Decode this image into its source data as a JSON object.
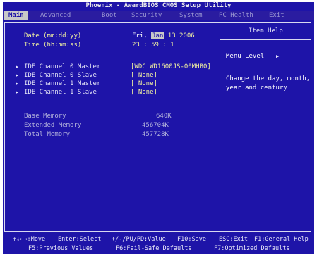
{
  "title": "Phoenix - AwardBIOS CMOS Setup Utility",
  "menu": [
    "Main",
    "Advanced",
    "Boot",
    "Security",
    "System",
    "PC Health",
    "Exit"
  ],
  "active_menu": "Main",
  "date": {
    "label": "Date (mm:dd:yy)",
    "day": "Fri,",
    "month": "Jan",
    "day_year": "13 2006"
  },
  "time": {
    "label": "Time (hh:mm:ss)",
    "value": "23 :  59 :  1"
  },
  "ide": [
    {
      "label": "IDE Channel 0 Master",
      "value": "[WDC WD1600JS-00MHB0]"
    },
    {
      "label": "IDE Channel 0 Slave",
      "value": "[ None]"
    },
    {
      "label": "IDE Channel 1 Master",
      "value": "[ None]"
    },
    {
      "label": "IDE Channel 1 Slave",
      "value": "[ None]"
    }
  ],
  "memory": [
    {
      "label": "Base Memory",
      "value": "640K"
    },
    {
      "label": "Extended Memory",
      "value": "456704K"
    },
    {
      "label": "Total Memory",
      "value": "457728K"
    }
  ],
  "help": {
    "title": "Item Help",
    "menu_level_label": "Menu Level",
    "menu_level_arrow": "▶",
    "text_line1": "Change the day, month,",
    "text_line2": "year and century"
  },
  "footer": {
    "line1": [
      "↑↓←→:Move",
      "Enter:Select",
      "+/-/PU/PD:Value",
      "F10:Save",
      "ESC:Exit",
      "F1:General Help"
    ],
    "line2": [
      "F5:Previous Values",
      "F6:Fail-Safe Defaults",
      "F7:Optimized Defaults"
    ]
  },
  "colors": {
    "background": "#1e14a8",
    "highlight": "#c8c8c8",
    "value_text": "#f0f0a0"
  }
}
